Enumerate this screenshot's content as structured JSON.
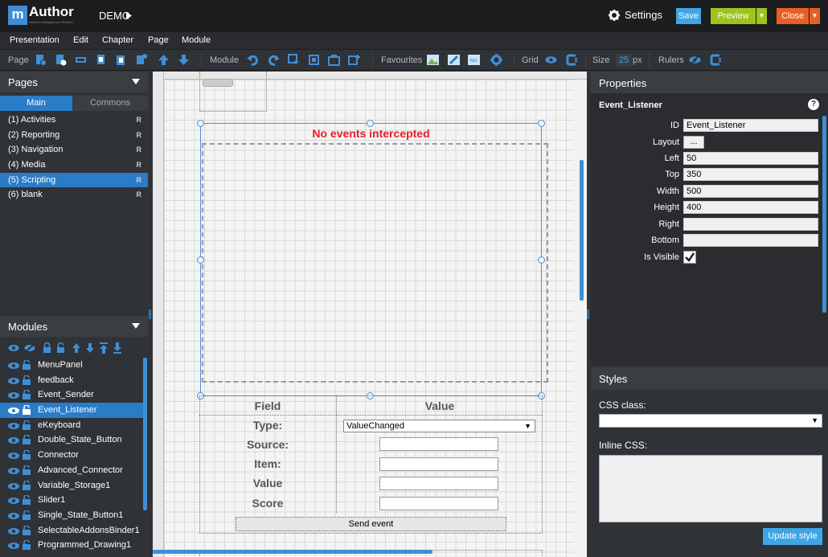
{
  "app": {
    "logo_letter": "m",
    "logo_text": "Author",
    "logo_sub": "mAuthor Management Platform",
    "presentation_name": "DEMO",
    "settings_label": "Settings",
    "save_label": "Save",
    "preview_label": "Preview",
    "close_label": "Close",
    "dropdown_glyph": "▼"
  },
  "menu": [
    "Presentation",
    "Edit",
    "Chapter",
    "Page",
    "Module"
  ],
  "toolbar": {
    "page_label": "Page",
    "module_label": "Module",
    "favourites_label": "Favourites",
    "grid_label": "Grid",
    "size_label": "Size",
    "size_value": "25",
    "size_unit": "px",
    "rulers_label": "Rulers"
  },
  "pages_panel": {
    "title": "Pages",
    "tabs": [
      "Main",
      "Commons"
    ],
    "items": [
      {
        "label": "(1) Activities",
        "flag": "R"
      },
      {
        "label": "(2) Reporting",
        "flag": "R"
      },
      {
        "label": "(3) Navigation",
        "flag": "R"
      },
      {
        "label": "(4) Media",
        "flag": "R"
      },
      {
        "label": "(5) Scripting",
        "flag": "R",
        "selected": true
      },
      {
        "label": "(6) blank",
        "flag": "R"
      }
    ]
  },
  "modules_panel": {
    "title": "Modules",
    "items": [
      "MenuPanel",
      "feedback",
      "Event_Sender",
      "Event_Listener",
      "eKeyboard",
      "Double_State_Button",
      "Connector",
      "Advanced_Connector",
      "Variable_Storage1",
      "Slider1",
      "Single_State_Button1",
      "SelectableAddonsBinder1",
      "Programmed_Drawing1"
    ],
    "selected_index": 3
  },
  "canvas": {
    "listener_title": "No events intercepted",
    "sender": {
      "field_header": "Field",
      "value_header": "Value",
      "type_label": "Type:",
      "type_value": "ValueChanged",
      "source_label": "Source:",
      "item_label": "Item:",
      "value_label": "Value",
      "score_label": "Score",
      "send_label": "Send event"
    }
  },
  "properties": {
    "title": "Properties",
    "module_name": "Event_Listener",
    "help_glyph": "?",
    "fields": {
      "id_label": "ID",
      "id_value": "Event_Listener",
      "layout_label": "Layout",
      "layout_button": "...",
      "left_label": "Left",
      "left_value": "50",
      "top_label": "Top",
      "top_value": "350",
      "width_label": "Width",
      "width_value": "500",
      "height_label": "Height",
      "height_value": "400",
      "right_label": "Right",
      "right_value": "",
      "bottom_label": "Bottom",
      "bottom_value": "",
      "visible_label": "Is Visible",
      "visible_checked": true
    }
  },
  "styles": {
    "title": "Styles",
    "css_class_label": "CSS class:",
    "css_class_value": "",
    "inline_css_label": "Inline CSS:",
    "inline_css_value": "",
    "update_button": "Update style"
  },
  "colors": {
    "accent_blue": "#2a7cc7",
    "save": "#3ea6e4",
    "preview": "#9ec31a",
    "close": "#e85f23",
    "listener_title": "#e0202a"
  }
}
